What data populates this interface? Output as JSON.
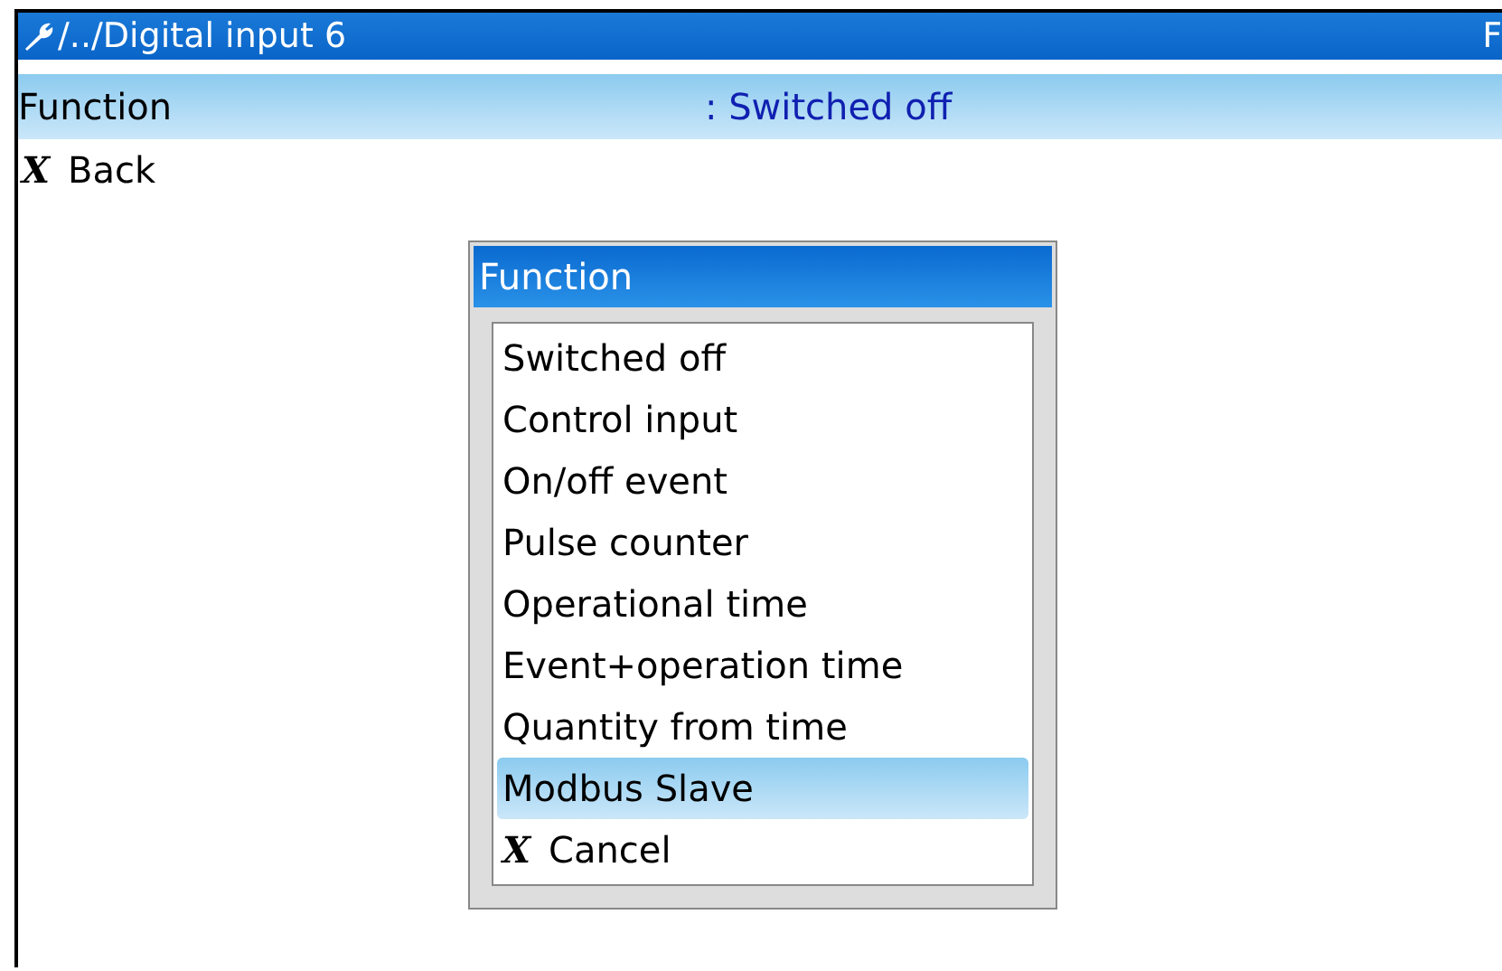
{
  "title_bar": {
    "path": "/../Digital input 6",
    "right_text": "F"
  },
  "setting": {
    "label": "Function",
    "value": ": Switched off",
    "selected": true
  },
  "back": {
    "icon": "X",
    "label": "Back"
  },
  "dialog": {
    "title": "Function",
    "options": [
      {
        "label": "Switched off",
        "selected": false
      },
      {
        "label": "Control input",
        "selected": false
      },
      {
        "label": "On/off event",
        "selected": false
      },
      {
        "label": "Pulse counter",
        "selected": false
      },
      {
        "label": "Operational time",
        "selected": false
      },
      {
        "label": "Event+operation time",
        "selected": false
      },
      {
        "label": "Quantity from time",
        "selected": false
      },
      {
        "label": "Modbus Slave",
        "selected": true
      },
      {
        "label": "Cancel",
        "icon": "X",
        "selected": false
      }
    ]
  }
}
